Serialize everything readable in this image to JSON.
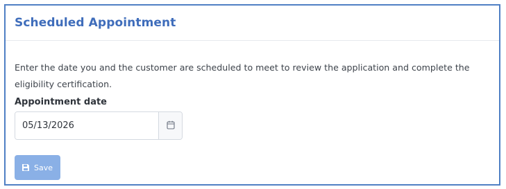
{
  "card": {
    "title": "Scheduled Appointment",
    "description": "Enter the date you and the customer are scheduled to meet to review the application and complete the eligibility certification."
  },
  "appointment_date": {
    "label": "Appointment date",
    "value": "05/13/2026",
    "calendar_icon": "calendar-icon"
  },
  "actions": {
    "save_label": "Save",
    "save_icon": "floppy-disk-icon",
    "save_disabled": true
  },
  "colors": {
    "title": "#3f6dbb",
    "frame_border": "#4f7fc4",
    "button_disabled": "#8ab0e6"
  }
}
